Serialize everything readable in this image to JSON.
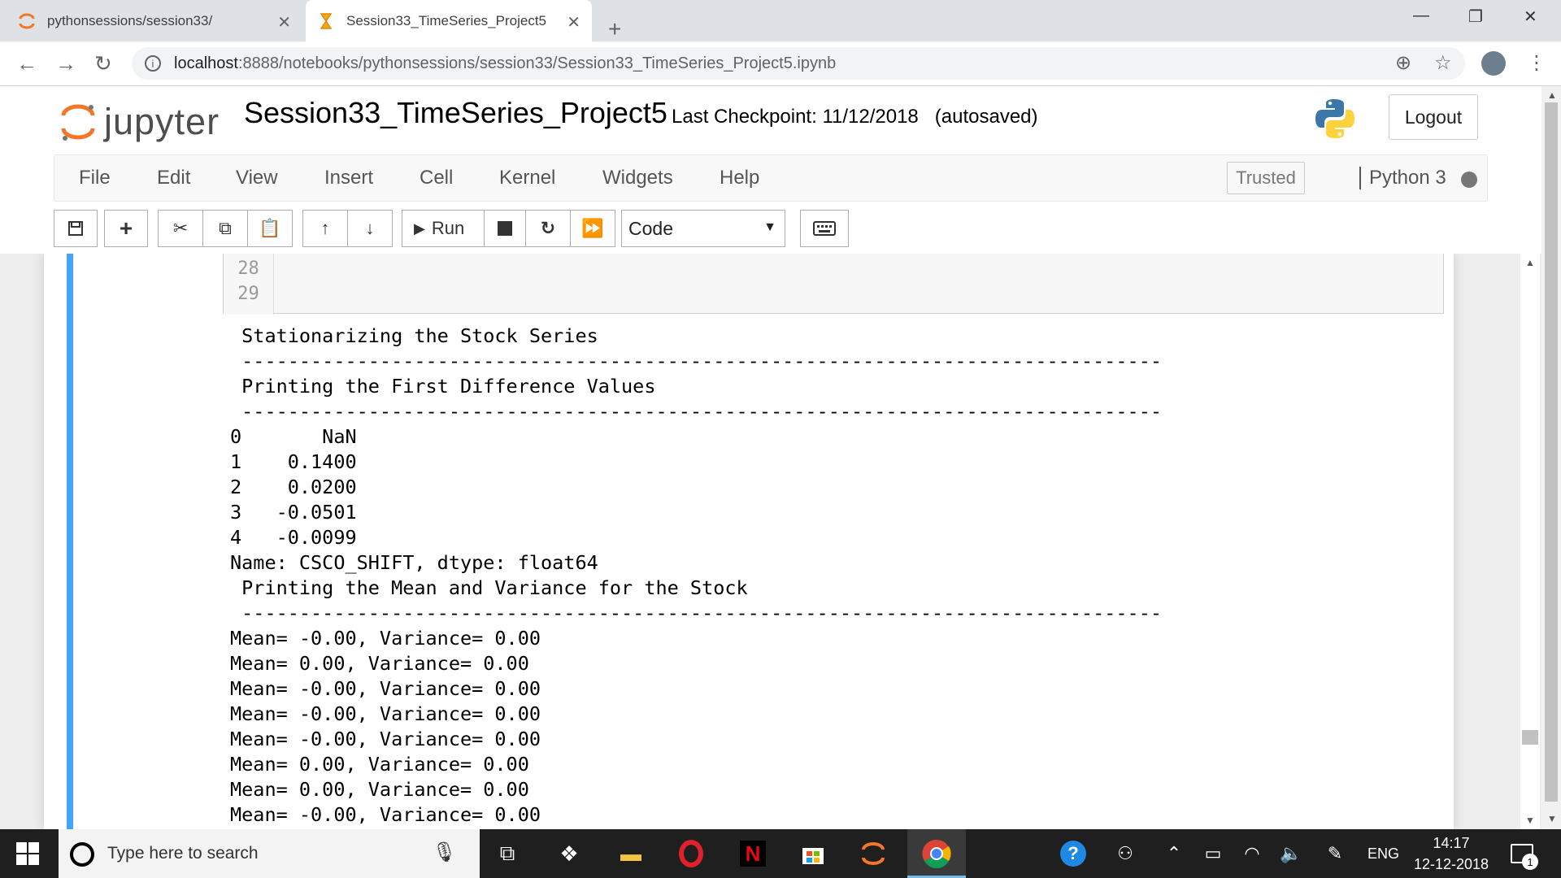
{
  "browser": {
    "tabs": [
      {
        "title": "pythonsessions/session33/"
      },
      {
        "title": "Session33_TimeSeries_Project5"
      }
    ],
    "url_host": "localhost",
    "url_path": ":8888/notebooks/pythonsessions/session33/Session33_TimeSeries_Project5.ipynb"
  },
  "jupyter": {
    "logo_text": "jupyter",
    "notebook_name": "Session33_TimeSeries_Project5",
    "checkpoint": "Last Checkpoint: 11/12/2018   (autosaved)",
    "logout_label": "Logout",
    "menus": [
      "File",
      "Edit",
      "View",
      "Insert",
      "Cell",
      "Kernel",
      "Widgets",
      "Help"
    ],
    "trusted_label": "Trusted",
    "kernel_name": "Python 3",
    "run_label": "Run",
    "cell_type": "Code"
  },
  "cell": {
    "line_numbers": [
      "28",
      "29"
    ],
    "output_lines": [
      " Stationarizing the Stock Series",
      " --------------------------------------------------------------------------------",
      " Printing the First Difference Values",
      " --------------------------------------------------------------------------------",
      "0       NaN",
      "1    0.1400",
      "2    0.0200",
      "3   -0.0501",
      "4   -0.0099",
      "Name: CSCO_SHIFT, dtype: float64",
      " Printing the Mean and Variance for the Stock",
      " --------------------------------------------------------------------------------",
      "Mean= -0.00, Variance= 0.00",
      "Mean= 0.00, Variance= 0.00",
      "Mean= -0.00, Variance= 0.00",
      "Mean= -0.00, Variance= 0.00",
      "Mean= -0.00, Variance= 0.00",
      "Mean= 0.00, Variance= 0.00",
      "Mean= 0.00, Variance= 0.00",
      "Mean= -0.00, Variance= 0.00"
    ]
  },
  "taskbar": {
    "search_placeholder": "Type here to search",
    "language": "ENG",
    "time": "14:17",
    "date": "12-12-2018",
    "notification_count": "1"
  },
  "colors": {
    "jupyter_orange": "#f37726",
    "cell_selected": "#42a5f5",
    "taskbar": "#1f1f1f"
  }
}
